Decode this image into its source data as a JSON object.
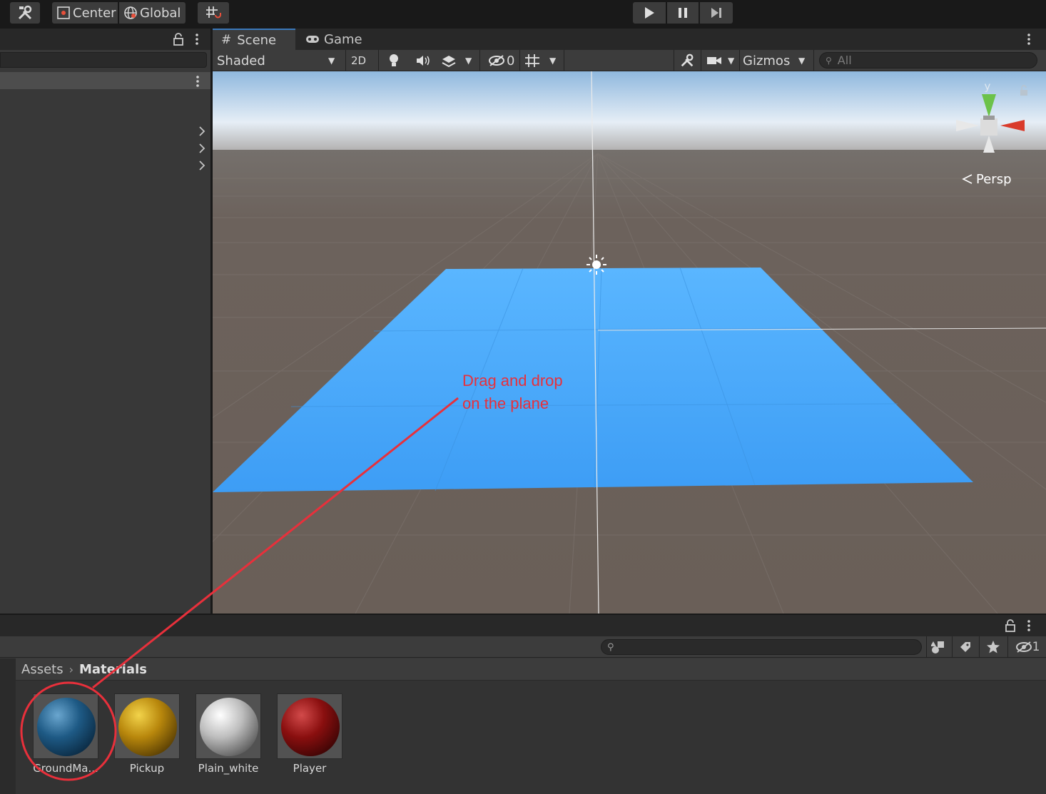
{
  "toolbar": {
    "pivot_mode_label": "Center",
    "pivot_rotation_label": "Global",
    "tool_icon": "tools-icon",
    "snap_icon": "grid-snap-icon",
    "play_icon": "play-icon",
    "pause_icon": "pause-icon",
    "step_icon": "step-icon"
  },
  "scene_panel": {
    "tabs": [
      {
        "label": "Scene",
        "icon": "hash-icon",
        "active": true
      },
      {
        "label": "Game",
        "icon": "gamepad-icon",
        "active": false
      }
    ],
    "draw_mode": "Shaded",
    "view_2d_label": "2D",
    "hidden_count": "0",
    "gizmos_label": "Gizmos",
    "search_placeholder": "All",
    "gizmo_axis_label": "y",
    "projection_label": "Persp"
  },
  "project_panel": {
    "breadcrumb": {
      "root": "Assets",
      "current": "Materials"
    },
    "hidden_packages_count": "1",
    "assets": [
      {
        "name": "GroundMa...",
        "color": "#1e5a85"
      },
      {
        "name": "Pickup",
        "color": "#b8870c"
      },
      {
        "name": "Plain_white",
        "color": "#bdbdbd"
      },
      {
        "name": "Player",
        "color": "#8a0f0f"
      }
    ]
  },
  "annotation": {
    "line1": "Drag and drop",
    "line2": "on the plane",
    "color": "#e8303b"
  },
  "colors": {
    "plane": "#4aa8ff",
    "ground": "#6b605a",
    "sky": "#c9d6e4"
  }
}
